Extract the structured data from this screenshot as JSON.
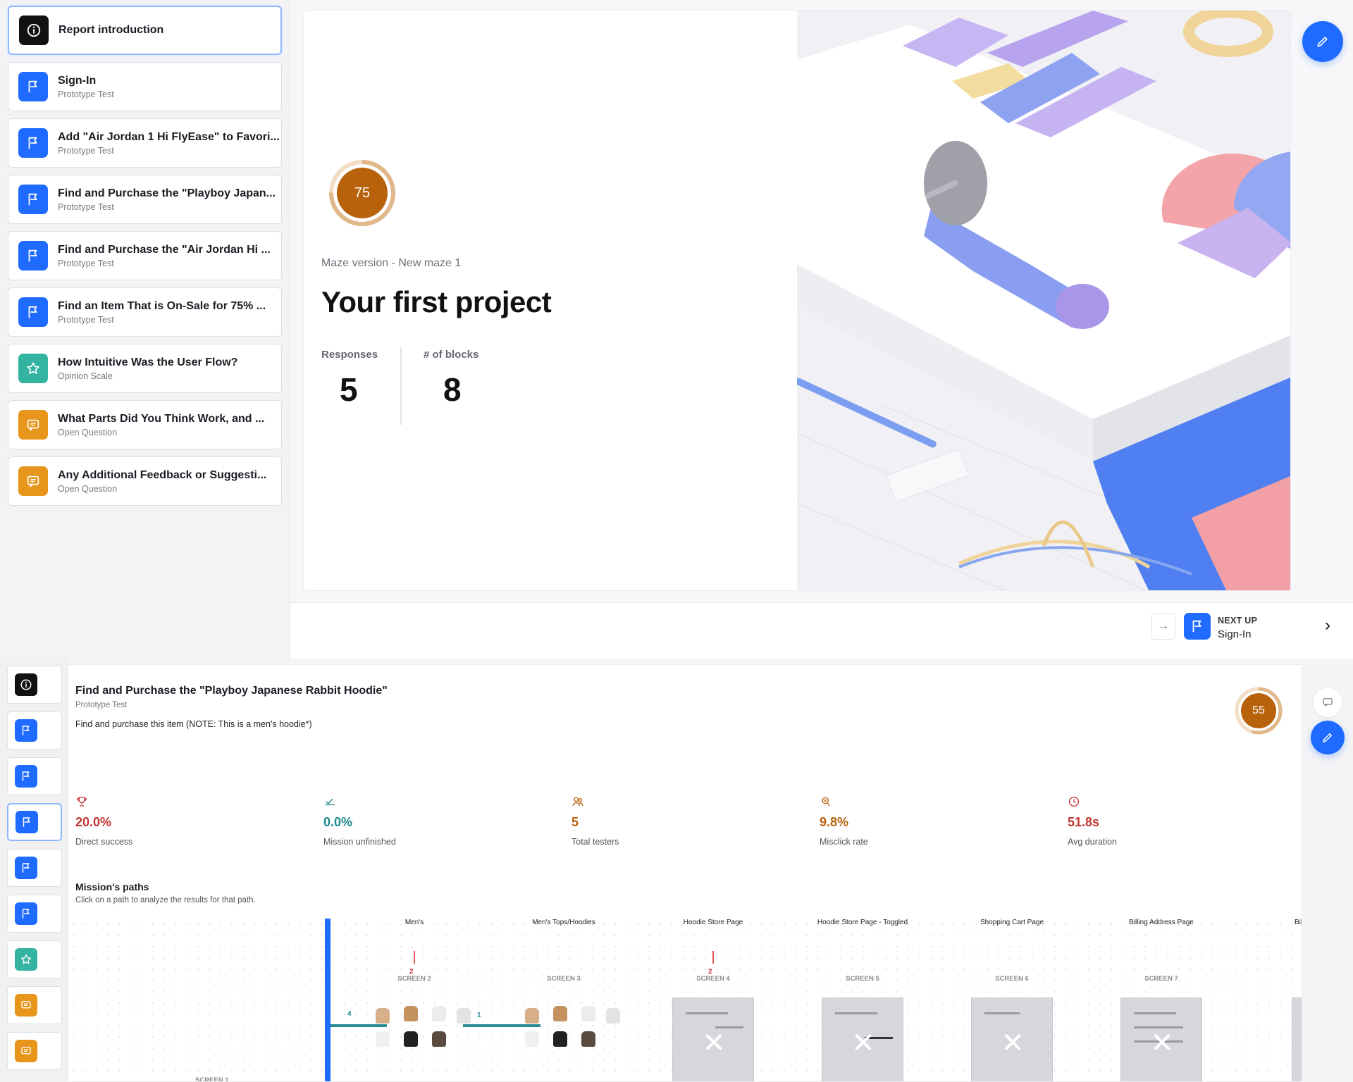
{
  "sidebar": {
    "items": [
      {
        "title": "Report introduction",
        "subtitle": "",
        "icon": "info-icon"
      },
      {
        "title": "Sign-In",
        "subtitle": "Prototype Test",
        "icon": "flag-icon"
      },
      {
        "title": "Add \"Air Jordan 1 Hi FlyEase\" to Favori...",
        "subtitle": "Prototype Test",
        "icon": "flag-icon"
      },
      {
        "title": "Find and Purchase the \"Playboy Japan...",
        "subtitle": "Prototype Test",
        "icon": "flag-icon"
      },
      {
        "title": "Find and Purchase the \"Air Jordan Hi ...",
        "subtitle": "Prototype Test",
        "icon": "flag-icon"
      },
      {
        "title": "Find an Item That is On-Sale for 75% ...",
        "subtitle": "Prototype Test",
        "icon": "flag-icon"
      },
      {
        "title": "How Intuitive Was the User Flow?",
        "subtitle": "Opinion Scale",
        "icon": "star-icon"
      },
      {
        "title": "What Parts Did You Think Work, and ...",
        "subtitle": "Open Question",
        "icon": "message-icon"
      },
      {
        "title": "Any Additional Feedback or Suggesti...",
        "subtitle": "Open Question",
        "icon": "message-icon"
      }
    ]
  },
  "intro": {
    "score": "75",
    "score_fraction": 0.75,
    "version": "Maze version - New maze 1",
    "title": "Your first project",
    "responses_label": "Responses",
    "responses_value": "5",
    "blocks_label": "# of blocks",
    "blocks_value": "8"
  },
  "next_up": {
    "label": "NEXT UP",
    "title": "Sign-In"
  },
  "task": {
    "title": "Find and Purchase the \"Playboy Japanese Rabbit Hoodie\"",
    "type": "Prototype Test",
    "description": "Find and purchase this item (NOTE: This is a men's hoodie*)",
    "score": "55",
    "score_fraction": 0.55,
    "metrics": [
      {
        "value": "20.0%",
        "label": "Direct success",
        "icon": "trophy-icon",
        "color": "#c53434"
      },
      {
        "value": "0.0%",
        "label": "Mission unfinished",
        "icon": "unfinished-icon",
        "color": "#1f8a8a"
      },
      {
        "value": "5",
        "label": "Total testers",
        "icon": "users-icon",
        "color": "#b8620c"
      },
      {
        "value": "9.8%",
        "label": "Misclick rate",
        "icon": "misclick-icon",
        "color": "#b8620c"
      },
      {
        "value": "51.8s",
        "label": "Avg duration",
        "icon": "clock-icon",
        "color": "#c53434"
      }
    ],
    "paths_title": "Mission's paths",
    "paths_subtitle": "Click on a path to analyze the results for that path.",
    "screens": [
      {
        "name": "Men's",
        "label": "SCREEN 2",
        "errors": "2"
      },
      {
        "name": "Men's Tops/Hoodies",
        "label": "SCREEN 3",
        "errors": ""
      },
      {
        "name": "Hoodie Store Page",
        "label": "SCREEN 4",
        "errors": "2"
      },
      {
        "name": "Hoodie Store Page - Toggled",
        "label": "SCREEN 5",
        "errors": ""
      },
      {
        "name": "Shopping Cart Page",
        "label": "SCREEN 6",
        "errors": ""
      },
      {
        "name": "Billing Address Page",
        "label": "SCREEN 7",
        "errors": ""
      },
      {
        "name": "Bil",
        "label": "",
        "errors": ""
      }
    ],
    "screen1_label": "SCREEN 1",
    "path_counts": [
      "4",
      "1"
    ]
  },
  "colors": {
    "accent": "#1f6bff",
    "score": "#b8620c",
    "flag": "#1f6bff",
    "star": "#34b3a0",
    "message": "#e8951c"
  }
}
